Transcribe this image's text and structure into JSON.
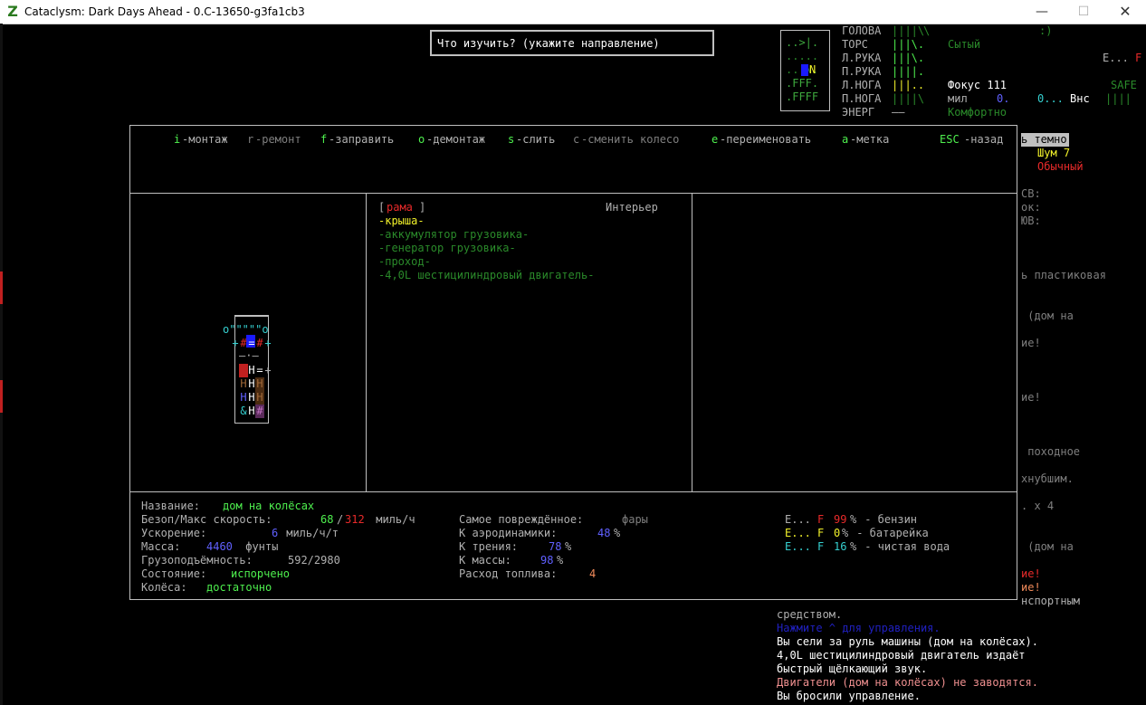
{
  "window": {
    "title": "Cataclysm: Dark Days Ahead - 0.C-13650-g3fa1cb3",
    "icon_letter": "Z",
    "min": "—",
    "max": "☐",
    "close": "✕"
  },
  "prompt": "Что изучить? (укажите направление)",
  "minimap": {
    "rows": [
      "..>|.",
      ".....",
      ".. N.",
      ".FFF.",
      ".FFFF"
    ]
  },
  "status": {
    "body": [
      {
        "label": "ГОЛОВА",
        "bars": "||||\\"
      },
      {
        "label": "ТОРС",
        "bars": "|||\\."
      },
      {
        "label": "Л.РУКА",
        "bars": "|||\\."
      },
      {
        "label": "П.РУКА",
        "bars": "||||."
      },
      {
        "label": "Л.НОГА",
        "bars": "|||.."
      },
      {
        "label": "П.НОГА",
        "bars": "||||\\"
      },
      {
        "label": "ЭНЕРГ",
        "bars": "——"
      }
    ],
    "smiley": ":)",
    "hunger": "Сытый",
    "focus": "Фокус 111",
    "speed_label": "мил",
    "speed_val": "0.",
    "zero2": "0...",
    "outside": "Внс",
    "comfort": "Комфортно",
    "fuel_e": "E...",
    "fuel_f": "F",
    "safe": "SAFE",
    "safe_bars": "||||"
  },
  "right_panel": {
    "dark": "ь темно",
    "noise": "Шум 7",
    "normal": "Обычный",
    "lines": [
      "СВ:",
      "ок:",
      "ЮВ:",
      "ь пластиковая",
      " (дом на",
      "ие!",
      "ие!",
      " походное",
      "хнубшим.",
      ". х 4",
      " (дом на",
      "ие!",
      "ие!",
      "нспортным"
    ]
  },
  "menu": {
    "items": [
      {
        "key": "i",
        "label": "-монтаж",
        "active": true
      },
      {
        "key": "r",
        "label": "-ремонт",
        "active": false
      },
      {
        "key": "f",
        "label": "-заправить",
        "active": true
      },
      {
        "key": "o",
        "label": "-демонтаж",
        "active": true
      },
      {
        "key": "s",
        "label": "-слить",
        "active": true
      },
      {
        "key": "c",
        "label": "-сменить колесо",
        "active": false
      },
      {
        "key": "e",
        "label": "-переименовать",
        "active": true
      },
      {
        "key": "a",
        "label": "-метка",
        "active": true
      }
    ],
    "esc_key": "ESC",
    "esc_label": "-назад"
  },
  "parts": {
    "header_left": "[",
    "header_name": "рама",
    "header_right": "]",
    "interior": "Интерьер",
    "list": [
      {
        "text": "-крыша-",
        "selected": true
      },
      {
        "text": "-аккумулятор грузовика-",
        "selected": false
      },
      {
        "text": "-генератор грузовика-",
        "selected": false
      },
      {
        "text": "-проход-",
        "selected": false
      },
      {
        "text": "-4,0L шестицилиндровый двигатель-",
        "selected": false
      }
    ]
  },
  "vehicle_map": {
    "row1": "o\"\"\"\"\"o",
    "row2": [
      "+",
      "#",
      "=",
      "#",
      "+"
    ],
    "row3": "—·—",
    "row4": [
      "#",
      "H",
      "=",
      "+"
    ],
    "row5": [
      "H",
      "H",
      "H"
    ],
    "row6": [
      "H",
      "H",
      "H"
    ],
    "row7": [
      "&",
      "H",
      "#"
    ]
  },
  "info": {
    "name_label": "Название: ",
    "name_val": "дом на колёсах",
    "speed_label": "Безоп/Макс скорость:  ",
    "speed_safe": "68",
    "speed_sep": "/",
    "speed_max": "312",
    "speed_unit": " миль/ч",
    "accel_label": "Ускорение:       ",
    "accel_val": "6",
    "accel_unit": " миль/ч/т",
    "mass_label": "Масса:  ",
    "mass_val": "4460",
    "mass_unit": " фунты",
    "cargo_label": "Грузоподъёмность: ",
    "cargo_val": "592/2980",
    "state_label": "Состояние: ",
    "state_val": "испорчено",
    "wheels_label": "Колёса: ",
    "wheels_val": "достаточно",
    "damaged_label": "Самое повреждённое: ",
    "damaged_val": "фары",
    "aero_label": "К аэродинамики:   ",
    "aero_val": "48",
    "pct": "%",
    "fric_label": "К трения:  ",
    "fric_val": "78",
    "massk_label": "К массы:  ",
    "massk_val": "98",
    "fuelc_label": "Расход топлива: ",
    "fuelc_val": "4"
  },
  "fuels": [
    {
      "e": "E...",
      "f": "F",
      "pct": "99",
      "pctsign": "%",
      "name": " - бензин"
    },
    {
      "e": "E...",
      "f": "F",
      "pct": "0",
      "pctsign": "%",
      "name": " - батарейка"
    },
    {
      "e": "E...",
      "f": "F",
      "pct": "16",
      "pctsign": "%",
      "name": " - чистая вода"
    }
  ],
  "log": [
    "средством.",
    "Нажмите ^ для управления.",
    "Вы сели за руль машины (дом на колёсах).",
    "4,0L шестицилиндровый двигатель издаёт",
    "быстрый щёлкающий звук.",
    "Двигатели (дом на колёсах) не заводятся.",
    "Вы бросили управление."
  ]
}
